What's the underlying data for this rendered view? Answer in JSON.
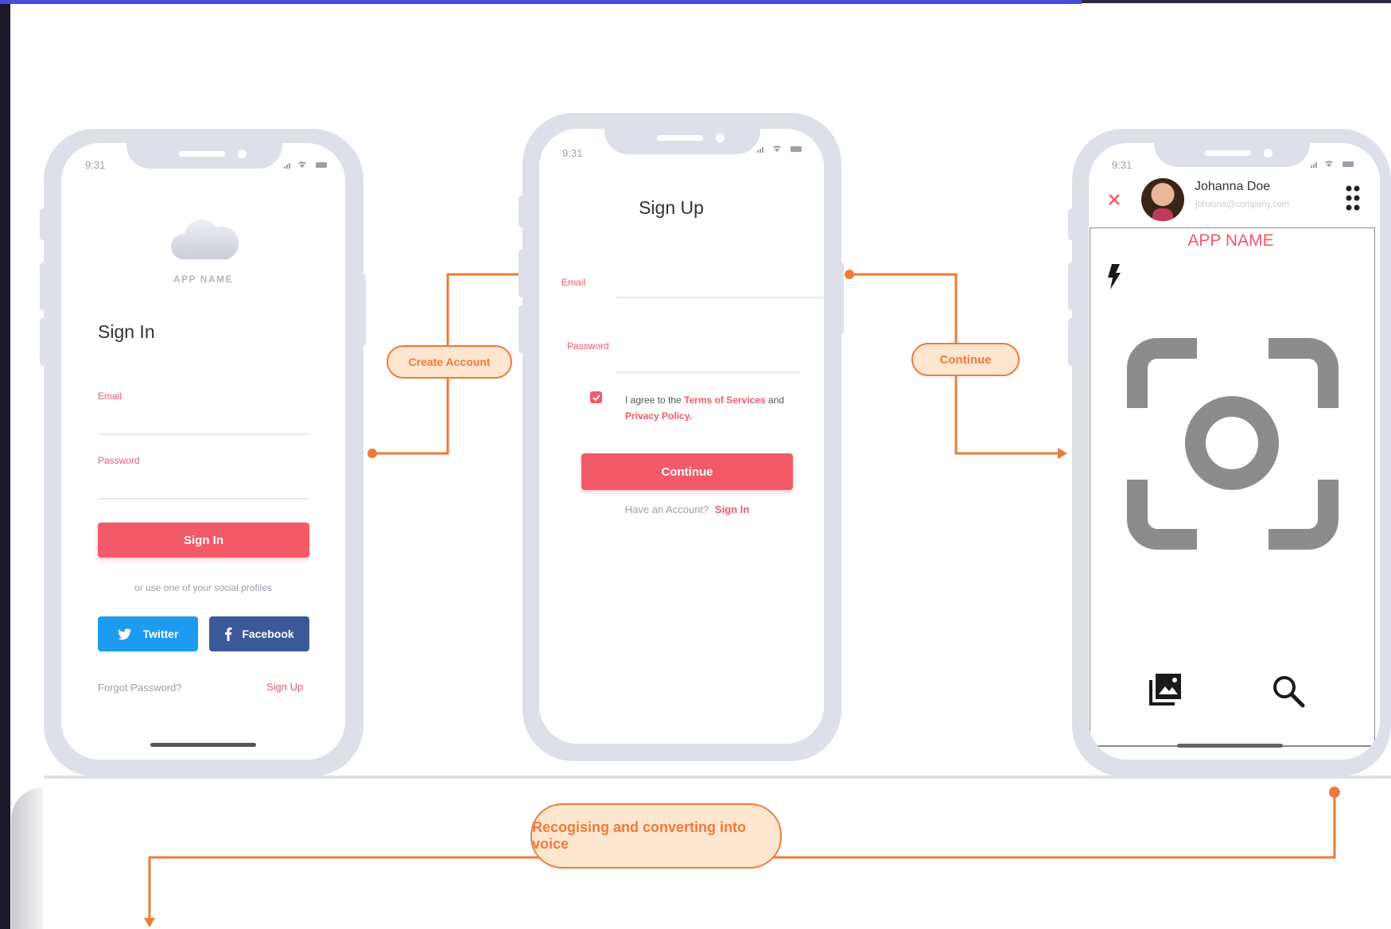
{
  "colors": {
    "accent": "#f05a6a",
    "flow": "#f07a3a",
    "pill_bg": "#fde6cf",
    "twitter": "#1d9bf0",
    "facebook": "#3b5998",
    "phone_frame": "#dde0e8"
  },
  "signin": {
    "time": "9:31",
    "app_name": "APP NAME",
    "title": "Sign In",
    "email_label": "Email",
    "password_label": "Password",
    "signin_button": "Sign In",
    "social_text": "or use one of your social profiles",
    "twitter_label": "Twitter",
    "facebook_label": "Facebook",
    "forgot_password": "Forgot Password?",
    "signup_link": "Sign Up"
  },
  "signup": {
    "time": "9:31",
    "title": "Sign Up",
    "email_label": "Email",
    "password_label": "Password",
    "agree_prefix": "I agree to the ",
    "terms_link": "Terms of Services",
    "agree_and": " and",
    "privacy_link": "Privacy Policy.",
    "continue_button": "Continue",
    "have_account": "Have an Account?",
    "signin_link": "Sign In"
  },
  "camera": {
    "time": "9:31",
    "user_name": "Johanna Doe",
    "user_email": "johanna@company.com",
    "app_name": "APP NAME"
  },
  "flow": {
    "create_account": "Create Account",
    "continue": "Continue",
    "recognising": "Recogising and  converting into voice"
  },
  "icons": [
    "cloud-icon",
    "twitter-icon",
    "facebook-icon",
    "checkbox-icon",
    "close-icon",
    "grid-icon",
    "flash-icon",
    "camera-focus-icon",
    "gallery-icon",
    "search-icon",
    "signal-icon",
    "wifi-icon",
    "battery-icon"
  ]
}
